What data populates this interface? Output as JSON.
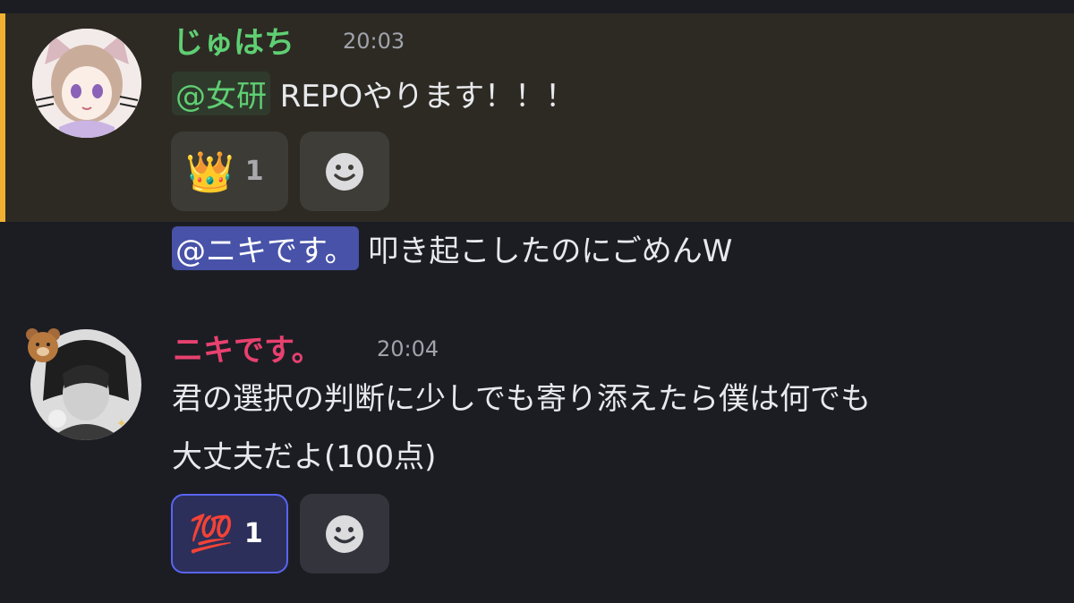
{
  "messages": [
    {
      "author": "じゅはち",
      "author_color": "#5fcf73",
      "time": "20:03",
      "mention": "@女研",
      "text": " REPOやります！！！",
      "reactions": [
        {
          "emoji": "👑",
          "count": "1"
        }
      ],
      "highlight_color": "#f0b132"
    },
    {
      "mention": "@ニキです。",
      "text": " 叩き起こしたのにごめんW"
    },
    {
      "author": "ニキです。",
      "author_color": "#e8416f",
      "time": "20:04",
      "lines": [
        "君の選択の判断に少しでも寄り添えたら僕は何でも",
        "大丈夫だよ(100点)"
      ],
      "reactions": [
        {
          "emoji": "💯",
          "count": "1"
        }
      ]
    }
  ],
  "icons": {
    "add_reaction": "smiley-add-reaction-icon"
  }
}
